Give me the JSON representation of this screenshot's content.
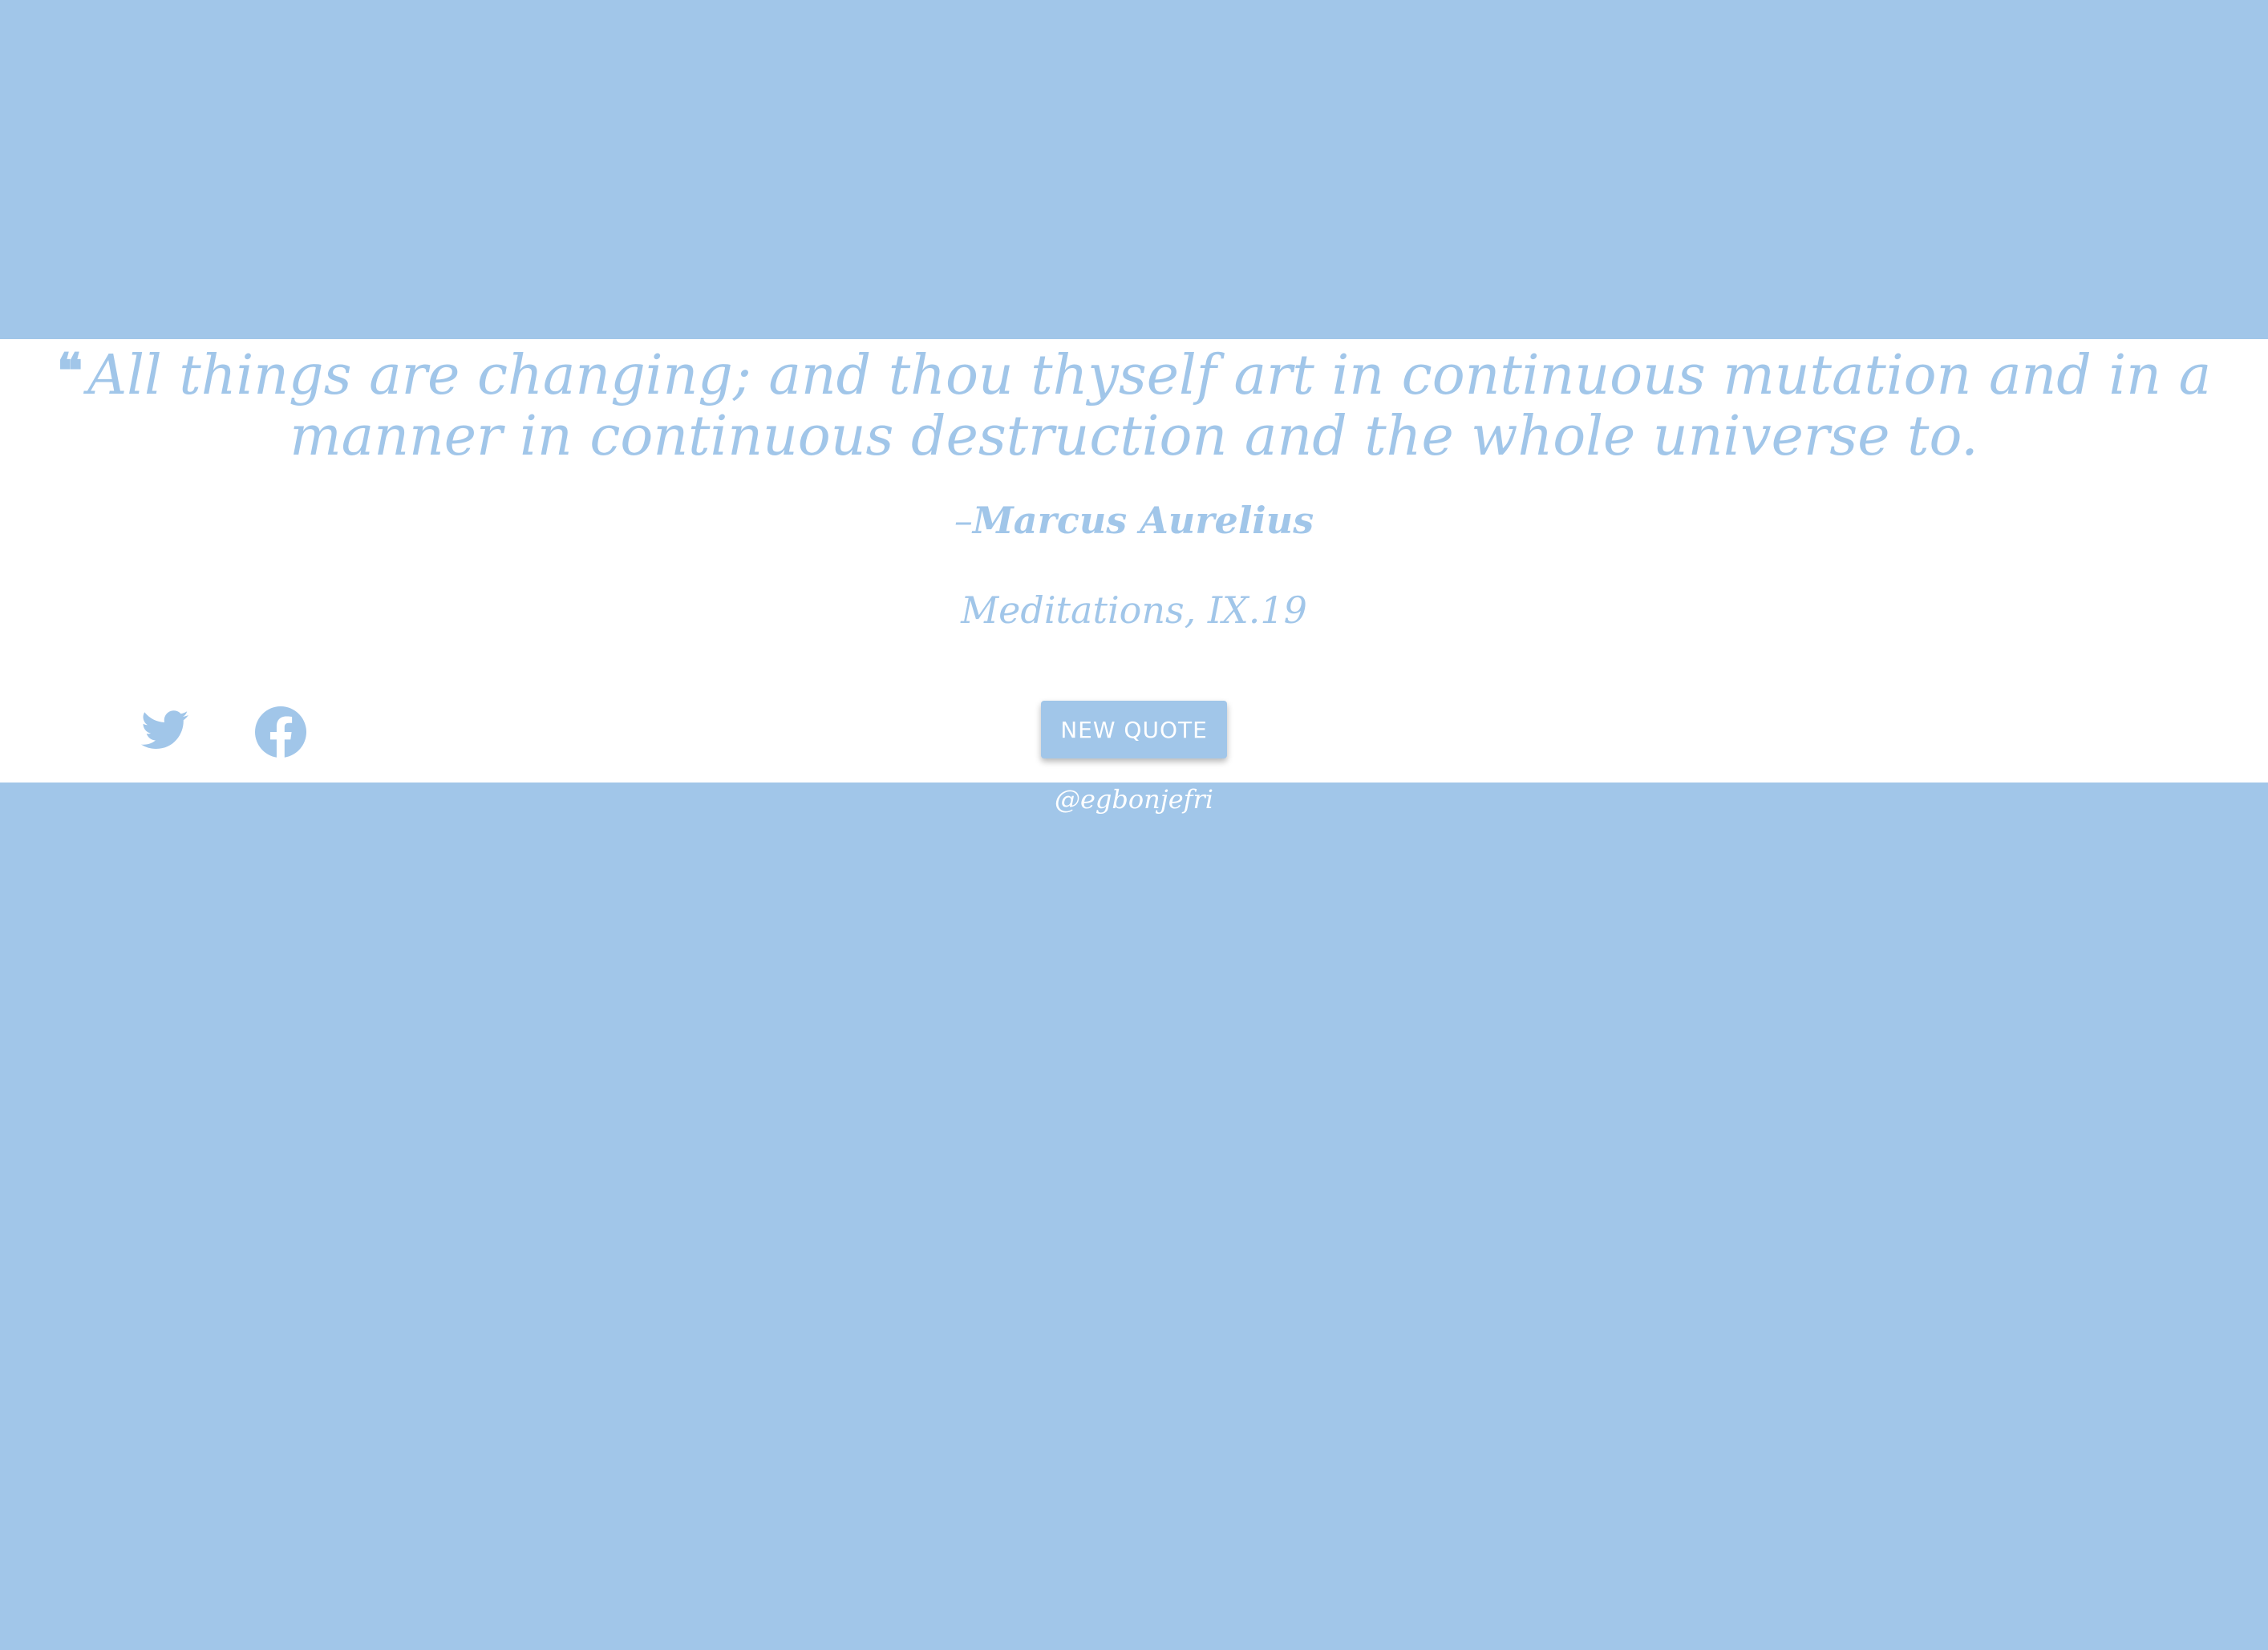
{
  "theme": {
    "background": "#a1c6e9",
    "card": "#ffffff",
    "accent": "#a1c6e9"
  },
  "quote": {
    "mark_icon": "quote-left-icon",
    "text": "All things are changing; and thou thyself art in continuous mutation and in a manner in continuous destruction and the whole universe to.",
    "author_prefix": "–",
    "author": "Marcus Aurelius",
    "source": "Meditations, IX.19"
  },
  "share": {
    "twitter_icon": "twitter-icon",
    "facebook_icon": "facebook-icon"
  },
  "actions": {
    "new_quote_label": "New quote"
  },
  "footer": {
    "handle": "@egbonjefri"
  }
}
